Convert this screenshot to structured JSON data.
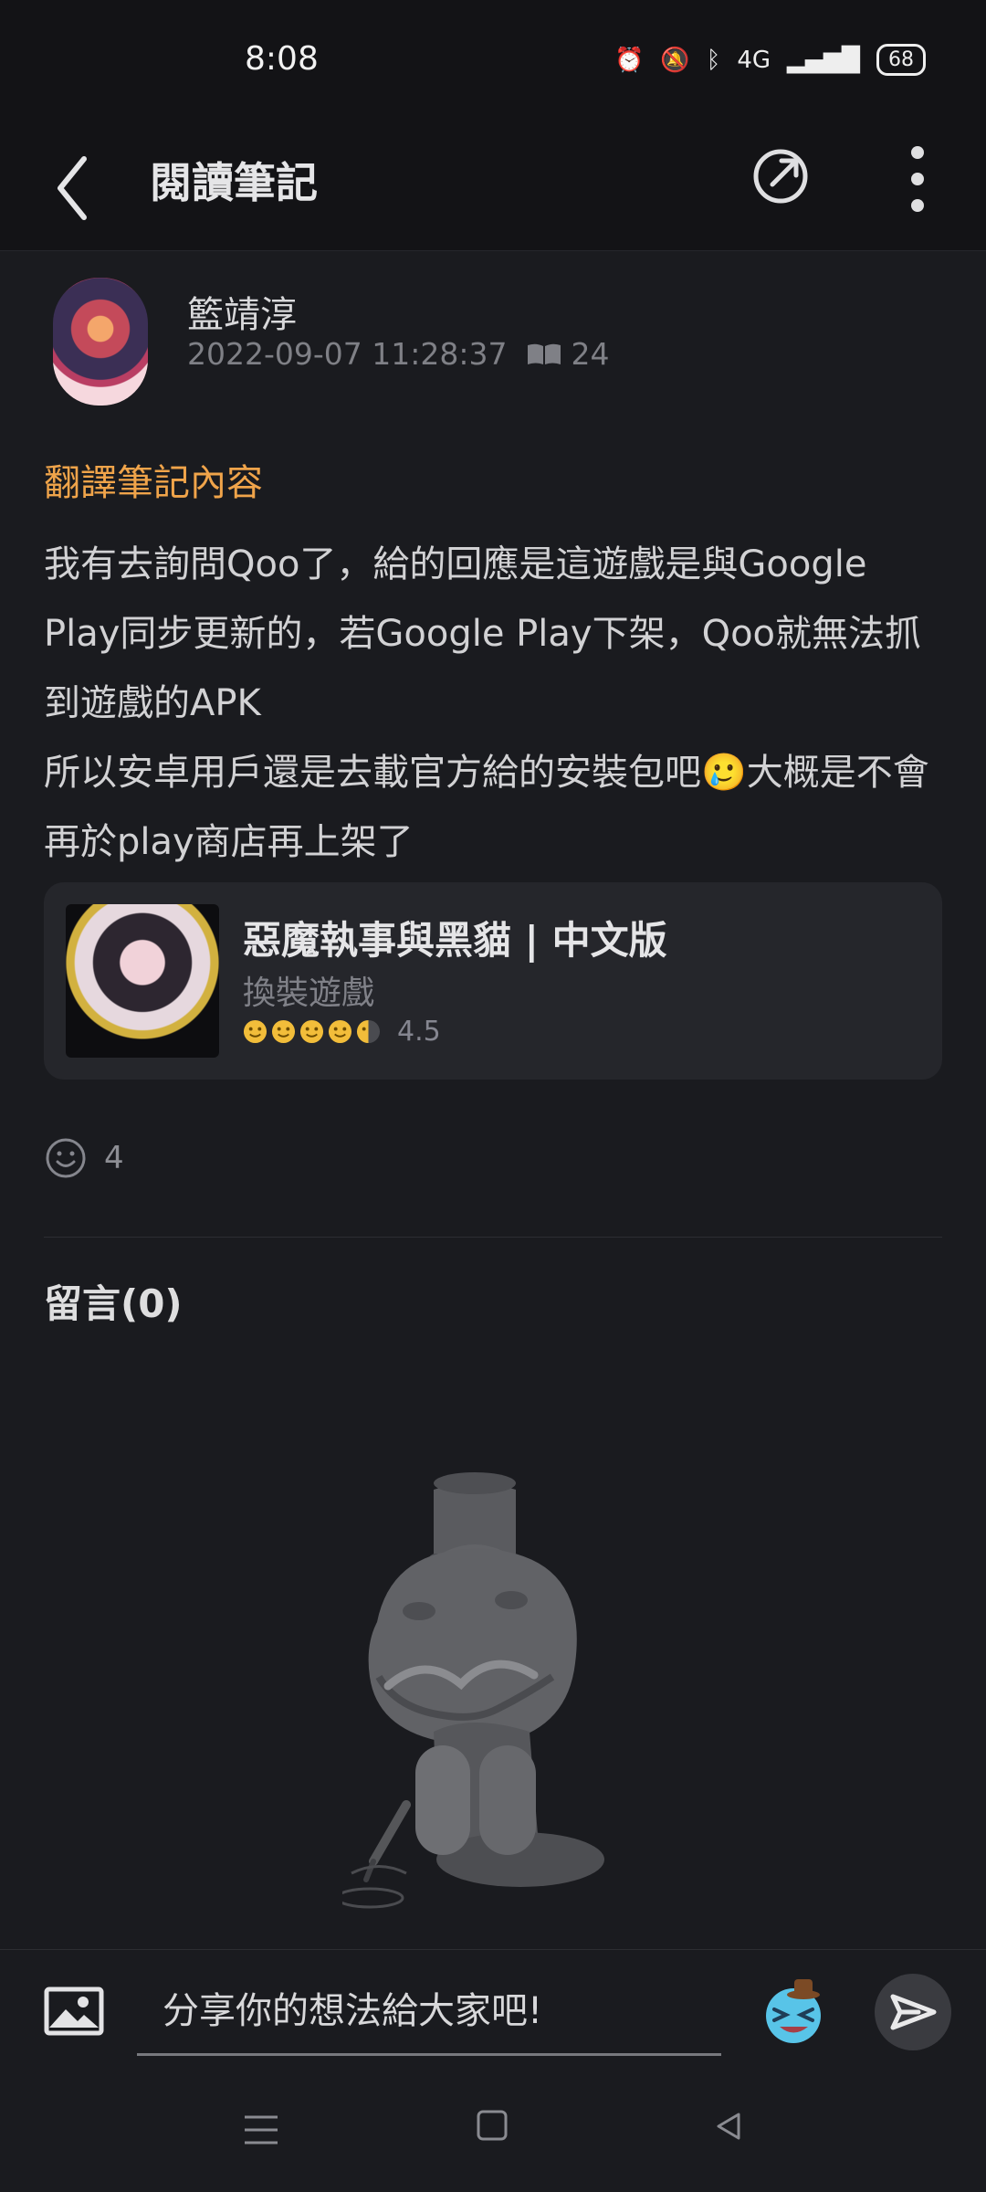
{
  "status": {
    "time": "8:08",
    "network": "4G",
    "battery": "68",
    "icons": [
      "alarm-icon",
      "mute-bell-icon",
      "bluetooth-icon",
      "signal-icon",
      "battery-icon"
    ]
  },
  "header": {
    "title": "閱讀筆記",
    "back_icon": "chevron-left-icon",
    "share_icon": "share-icon",
    "menu_icon": "more-vertical-icon"
  },
  "post": {
    "author": "籃靖淳",
    "timestamp": "2022-09-07 11:28:37",
    "read_count": "24",
    "section_title": "翻譯筆記內容",
    "body": [
      "我有去詢問Qoo了，給的回應是這遊戲是與Google Play同步更新的，若Google Play下架，Qoo就無法抓到遊戲的APK",
      "所以安卓用戶還是去載官方給的安裝包吧🥲大概是不會再於play商店再上架了"
    ]
  },
  "game": {
    "title": "惡魔執事與黑貓 | 中文版",
    "genre": "換裝遊戲",
    "rating": "4.5",
    "rating_value": 4.5
  },
  "reactions": {
    "count": "4",
    "icon": "smiley-icon"
  },
  "comments": {
    "title": "留言(0)",
    "illustration": "thinking-mascot-icon"
  },
  "composer": {
    "placeholder": "分享你的想法給大家吧!",
    "image_icon": "image-icon",
    "emoji_icon": "emoji-mascot-icon",
    "send_icon": "send-icon"
  },
  "navigation": {
    "recent_icon": "recent-apps-icon",
    "home_icon": "home-icon",
    "back_icon": "back-triangle-icon"
  }
}
